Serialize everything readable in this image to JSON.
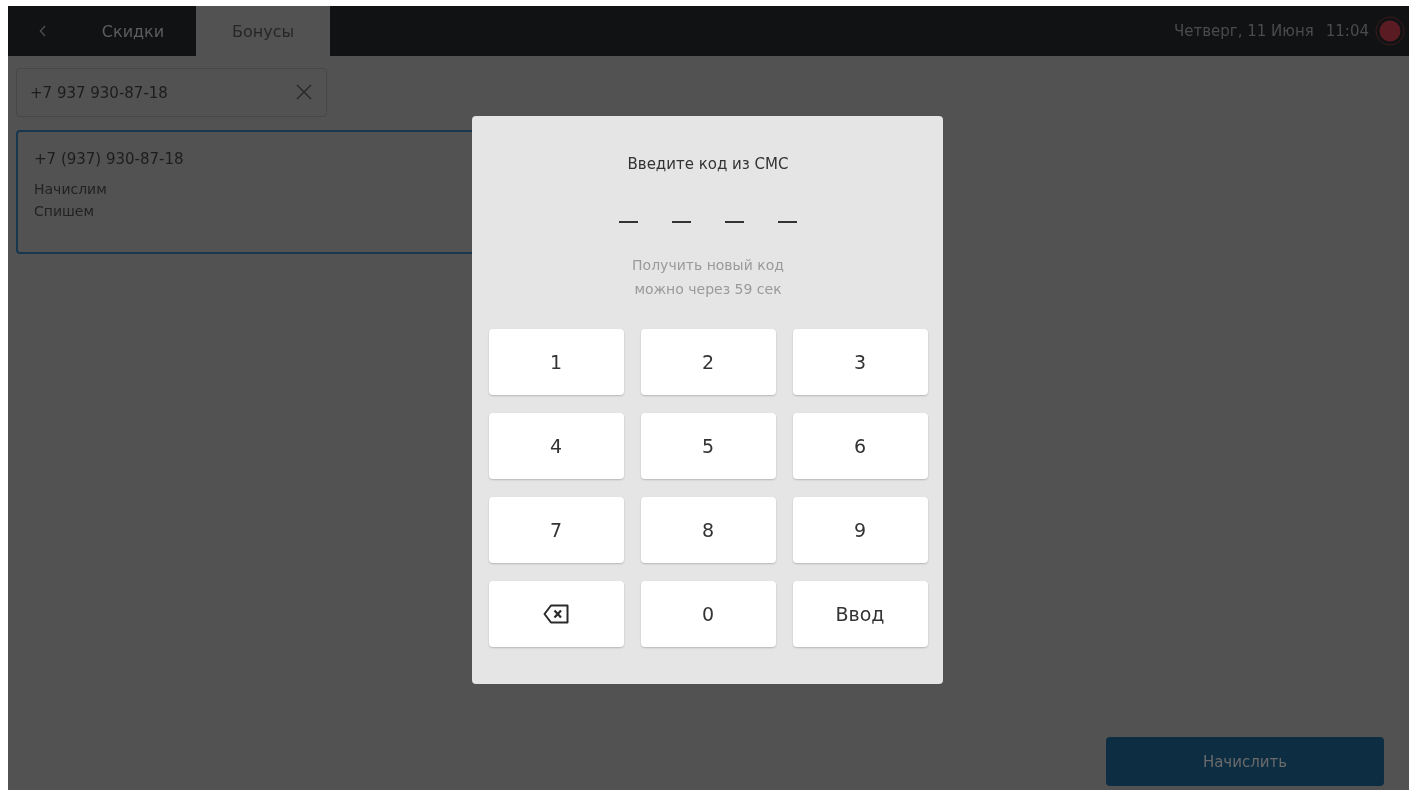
{
  "top_bar": {
    "tabs": [
      {
        "label": "Скидки",
        "selected": false
      },
      {
        "label": "Бонусы",
        "selected": true
      }
    ],
    "date": "Четверг, 11 Июня",
    "time": "11:04"
  },
  "search": {
    "value": "+7 937 930-87-18"
  },
  "customer_card": {
    "selected": true,
    "phone": "+7 (937) 930-87-18",
    "lines": [
      "Начислим",
      "Спишем"
    ]
  },
  "dialog": {
    "title": "Введите код из СМС",
    "code_slots": [
      {
        "filled": false
      },
      {
        "filled": false
      },
      {
        "filled": false
      },
      {
        "filled": false
      }
    ],
    "hint_lines": [
      "Получить новый код",
      "можно через 59 сек"
    ],
    "keys": [
      {
        "kind": "digit",
        "label": "1"
      },
      {
        "kind": "digit",
        "label": "2"
      },
      {
        "kind": "digit",
        "label": "3"
      },
      {
        "kind": "digit",
        "label": "4"
      },
      {
        "kind": "digit",
        "label": "5"
      },
      {
        "kind": "digit",
        "label": "6"
      },
      {
        "kind": "digit",
        "label": "7"
      },
      {
        "kind": "digit",
        "label": "8"
      },
      {
        "kind": "digit",
        "label": "9"
      },
      {
        "kind": "backspace"
      },
      {
        "kind": "digit",
        "label": "0"
      },
      {
        "kind": "enter",
        "label": "Ввод"
      }
    ]
  },
  "action_button": {
    "label": "Начислить"
  }
}
